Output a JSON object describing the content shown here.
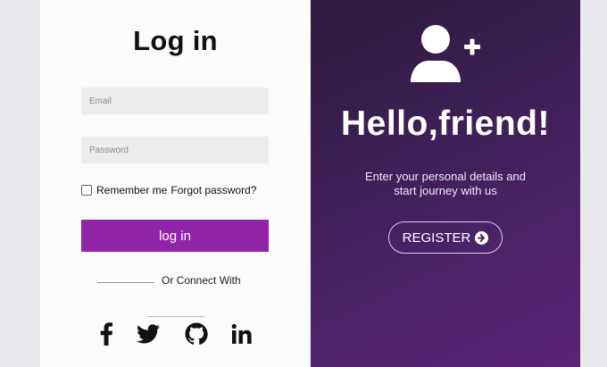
{
  "login": {
    "title": "Log in",
    "email_placeholder": "Email",
    "password_placeholder": "Password",
    "remember_label": "Remember me",
    "forgot_label": "Forgot password?",
    "submit_label": "log in",
    "connect_label": "Or Connect With",
    "social": [
      "facebook-icon",
      "twitter-icon",
      "github-icon",
      "linkedin-icon"
    ]
  },
  "welcome": {
    "icon": "user-plus-icon",
    "heading": "Hello,friend!",
    "line1": "Enter your personal details and",
    "line2": "start journey with us",
    "register_label": "REGISTER",
    "register_icon": "arrow-circle-right-icon"
  },
  "colors": {
    "accent": "#9224a8",
    "panel_dark": "#2d1a3c",
    "panel_light": "#5c2478",
    "page_bg": "#e8e9ec"
  }
}
